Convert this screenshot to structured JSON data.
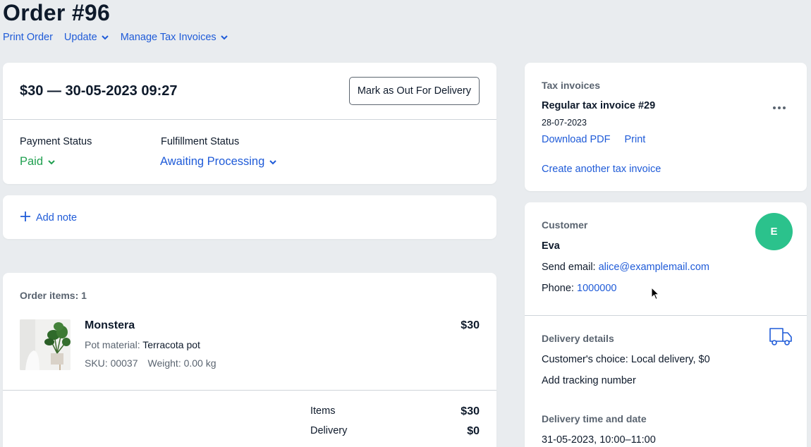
{
  "header": {
    "title": "Order  #96",
    "nav": {
      "print": "Print Order",
      "update": "Update",
      "tax": "Manage Tax Invoices"
    }
  },
  "summary": {
    "heading": "$30 — 30-05-2023 09:27",
    "button": "Mark as Out For Delivery",
    "payment_label": "Payment Status",
    "payment_value": "Paid",
    "fulfillment_label": "Fulfillment Status",
    "fulfillment_value": "Awaiting Processing"
  },
  "note": {
    "add": "Add note"
  },
  "items": {
    "title": "Order items: 1",
    "product": {
      "name": "Monstera",
      "price": "$30",
      "option_label": "Pot material:",
      "option_value": "Terracota pot",
      "sku": "SKU: 00037",
      "weight": "Weight: 0.00 kg"
    },
    "totals": [
      {
        "label": "Items",
        "value": "$30"
      },
      {
        "label": "Delivery",
        "value": "$0"
      }
    ]
  },
  "tax": {
    "title": "Tax invoices",
    "invoice_name": "Regular tax invoice #29",
    "invoice_date": "28-07-2023",
    "download": "Download PDF",
    "print": "Print",
    "create": "Create another tax invoice"
  },
  "customer": {
    "title": "Customer",
    "avatar": "E",
    "name": "Eva",
    "email_label": "Send email:",
    "email": "alice@examplemail.com",
    "phone_label": "Phone:",
    "phone": "1000000"
  },
  "delivery": {
    "title": "Delivery details",
    "choice": "Customer's choice: Local delivery, $0",
    "tracking": "Add tracking number",
    "time_title": "Delivery time and date",
    "time_value": "31-05-2023, 10:00–11:00"
  },
  "colors": {
    "accent": "#1f5bd8",
    "paid": "#20a050",
    "avatar": "#2bc28c",
    "background": "#e9ecef"
  },
  "icons": [
    "chevron-down-icon",
    "plus-icon",
    "more-dots-icon",
    "truck-icon",
    "cursor-icon"
  ]
}
